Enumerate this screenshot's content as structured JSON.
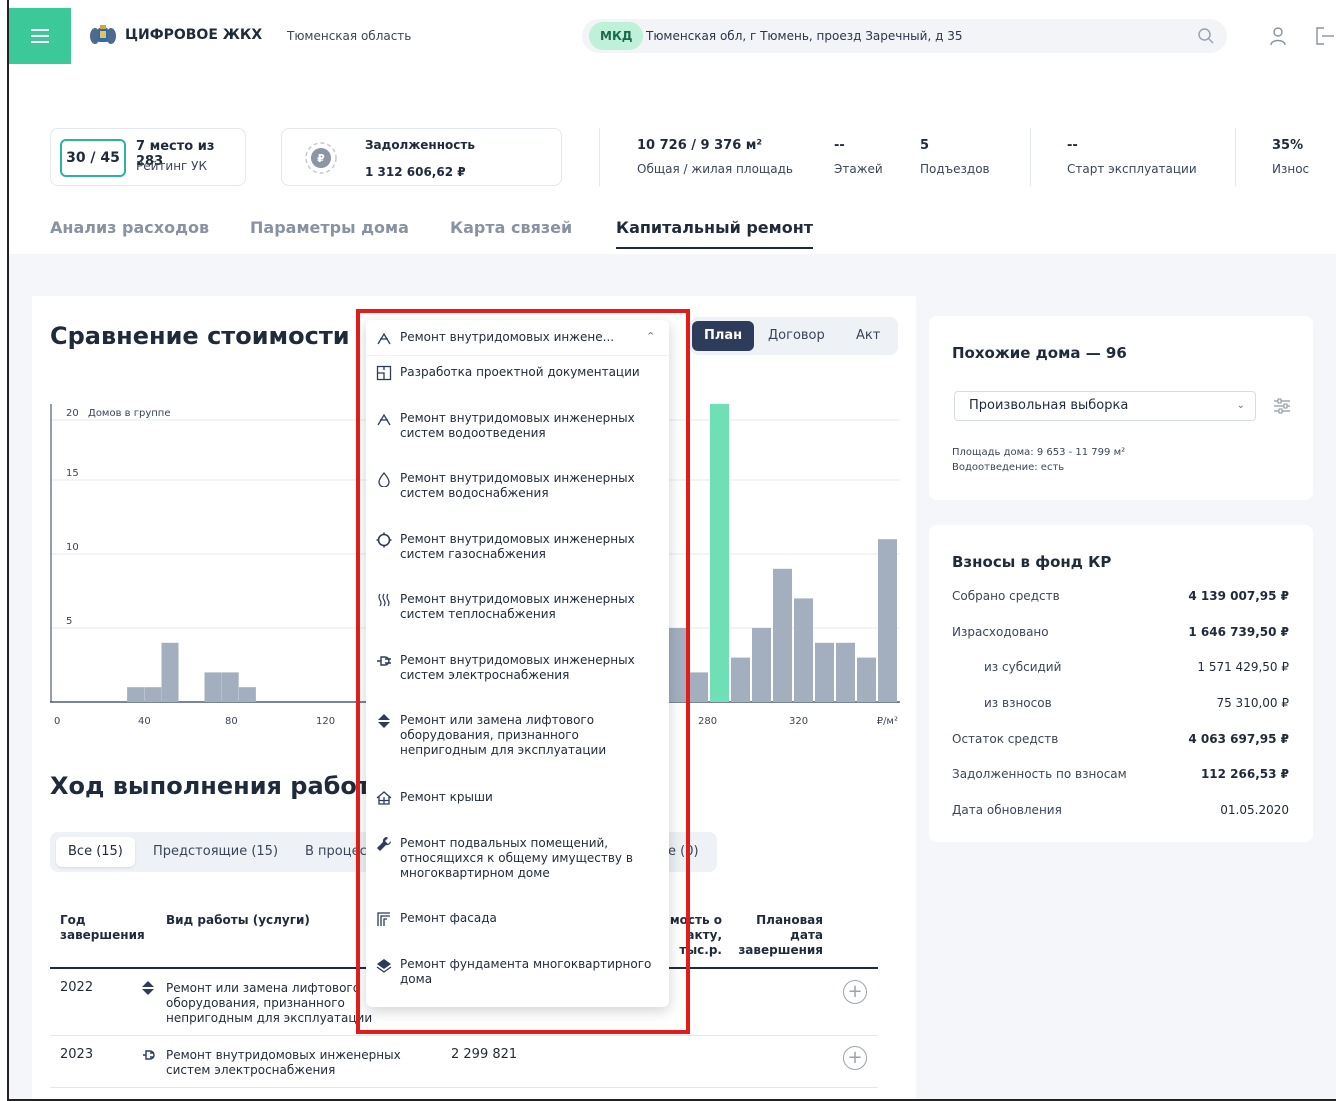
{
  "header": {
    "brand": "ЦИФРОВОЕ ЖКХ",
    "region": "Тюменская область",
    "badge": "МКД",
    "address": "Тюменская обл, г Тюмень, проезд Заречный, д 35"
  },
  "stats": {
    "rating_score": "30 / 45",
    "rating_place": "7 место из 283",
    "rating_label": "Рейтинг УК",
    "debt_title": "Задолженность",
    "debt_value": "1 312 606,62 ₽",
    "area_value": "10 726 / 9 376 м²",
    "area_label": "Общая / жилая площадь",
    "floors_value": "--",
    "floors_label": "Этажей",
    "entrances_value": "5",
    "entrances_label": "Подъездов",
    "start_value": "--",
    "start_label": "Старт эксплуатации",
    "wear_value": "35%",
    "wear_label": "Износ"
  },
  "tabs": [
    "Анализ расходов",
    "Параметры дома",
    "Карта связей",
    "Капитальный ремонт"
  ],
  "comparison": {
    "title": "Сравнение стоимости",
    "modes": [
      "План",
      "Договор",
      "Акт"
    ]
  },
  "chart_data": {
    "type": "bar",
    "ylabel": "Домов в группе",
    "xunit": "₽/м²",
    "yticks": [
      5,
      10,
      15,
      20
    ],
    "xticks": [
      "0",
      "40",
      "80",
      "120",
      "280",
      "320"
    ],
    "ylim": [
      0,
      20
    ],
    "bins_left": [
      {
        "x": 34,
        "value": 1
      },
      {
        "x": 42,
        "value": 1
      },
      {
        "x": 50,
        "value": 4
      },
      {
        "x": 70,
        "value": 2
      },
      {
        "x": 78,
        "value": 2
      },
      {
        "x": 86,
        "value": 1
      }
    ],
    "bins_right": [
      {
        "x": 270,
        "value": 5
      },
      {
        "x": 278,
        "value": 2
      },
      {
        "x": 286,
        "value": 20,
        "highlight": true
      },
      {
        "x": 294,
        "value": 3
      },
      {
        "x": 302,
        "value": 5
      },
      {
        "x": 310,
        "value": 9
      },
      {
        "x": 318,
        "value": 7
      },
      {
        "x": 326,
        "value": 4
      },
      {
        "x": 334,
        "value": 4
      },
      {
        "x": 342,
        "value": 3
      },
      {
        "x": 350,
        "value": 11
      }
    ],
    "bar_color": "#a3afbf",
    "highlight_color": "#6fe0b6"
  },
  "progress": {
    "title": "Ход выполнения работ",
    "filters": [
      "Все (15)",
      "Предстоящие (15)",
      "В процессе",
      "е (0)"
    ],
    "columns": {
      "year": "Год завершения",
      "work": "Вид работы (услуги)",
      "cost_act": "имость о акту, тыс.р.",
      "planned": "Плановая дата завершения"
    },
    "rows": [
      {
        "year": "2022",
        "work": "Ремонт или замена лифтового оборудования, признанного непригодным для эксплуатации",
        "cost": ""
      },
      {
        "year": "2023",
        "work": "Ремонт внутридомовых инженерных систем электроснабжения",
        "cost": "2 299 821"
      }
    ]
  },
  "similar": {
    "title": "Похожие дома — 96",
    "select_value": "Произвольная выборка",
    "note1": "Площадь дома: 9 653 - 11 799 м²",
    "note2": "Водоотведение: есть"
  },
  "fund": {
    "title": "Взносы в фонд КР",
    "rows": [
      {
        "label": "Собрано средств",
        "value": "4 139 007,95 ₽"
      },
      {
        "label": "Израсходовано",
        "value": "1 646 739,50 ₽"
      },
      {
        "label": "из субсидий",
        "value": "1 571 429,50 ₽"
      },
      {
        "label": "из взносов",
        "value": "75 310,00 ₽"
      },
      {
        "label": "Остаток средств",
        "value": "4 063 697,95 ₽"
      },
      {
        "label": "Задолженность по взносам",
        "value": "112 266,53 ₽"
      },
      {
        "label": "Дата обновления",
        "value": "01.05.2020"
      }
    ]
  },
  "dropdown": {
    "selected": "Ремонт внутридомовых инжене...",
    "items": [
      "Разработка проектной документации",
      "Ремонт внутридомовых инженерных систем водоотведения",
      "Ремонт внутридомовых инженерных систем водоснабжения",
      "Ремонт внутридомовых инженерных систем газоснабжения",
      "Ремонт внутридомовых инженерных систем теплоснабжения",
      "Ремонт внутридомовых инженерных систем электроснабжения",
      "Ремонт или замена лифтового оборудования, признанного непригодным для эксплуатации",
      "Ремонт крыши",
      "Ремонт подвальных помещений, относящихся к общему имуществу в многоквартирном доме",
      "Ремонт фасада",
      "Ремонт фундамента многоквартирного дома"
    ]
  },
  "colors": {
    "accent": "#3cc99a",
    "dark": "#2c3c5a",
    "highlight": "#e21b1b"
  }
}
